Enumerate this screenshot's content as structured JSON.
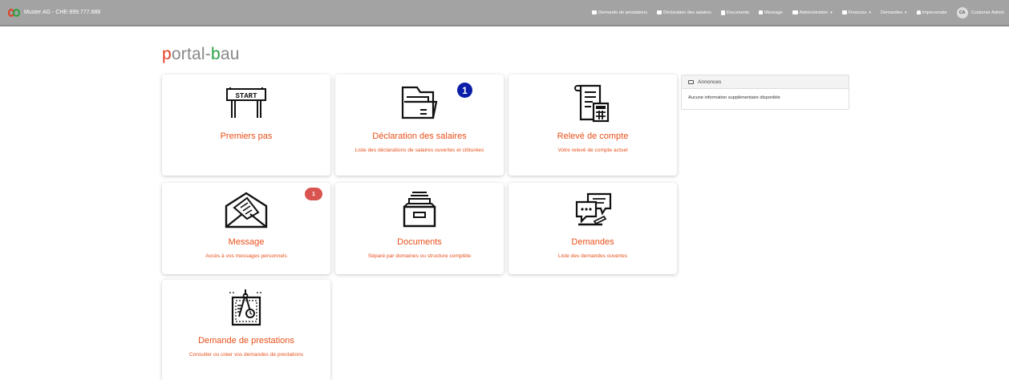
{
  "header": {
    "company": "Muster AG - CHE-999.777.888",
    "nav": [
      {
        "label": "Demande de prestations",
        "icon": "calendar-icon",
        "caret": false
      },
      {
        "label": "Déclaration des salaires",
        "icon": "table-icon",
        "caret": false
      },
      {
        "label": "Documents",
        "icon": "file-icon",
        "caret": false
      },
      {
        "label": "Message",
        "icon": "lock-icon",
        "caret": false
      },
      {
        "label": "Administration",
        "icon": "id-card-icon",
        "caret": true
      },
      {
        "label": "Finances",
        "icon": "table-icon",
        "caret": true
      },
      {
        "label": "Demandes",
        "icon": "",
        "caret": true
      },
      {
        "label": "Impersonate",
        "icon": "user-icon",
        "caret": false
      }
    ],
    "avatar_initials": "CA",
    "user": "Customer Admin",
    "caret": "▾"
  },
  "logo": {
    "p": "p",
    "mid": "ortal-",
    "b": "b",
    "end": "au"
  },
  "cards": [
    {
      "title": "Premiers pas",
      "desc": "",
      "icon": "start-sign-icon",
      "badge": ""
    },
    {
      "title": "Déclaration des salaires",
      "desc": "Liste des déclarations de salaires ouvertes et clôturées",
      "icon": "folder-icon",
      "badge": "1"
    },
    {
      "title": "Relevé de compte",
      "desc": "Votre relevé de compte actuel",
      "icon": "statement-calculator-icon",
      "badge": ""
    },
    {
      "title": "Message",
      "desc": "Accès à vos messages personnels",
      "icon": "envelope-icon",
      "badge": "1"
    },
    {
      "title": "Documents",
      "desc": "Séparé par domaines ou structure complète",
      "icon": "file-drawer-icon",
      "badge": ""
    },
    {
      "title": "Demandes",
      "desc": "Liste des demandes ouvertes",
      "icon": "chat-bubbles-icon",
      "badge": ""
    },
    {
      "title": "Demande de prestations",
      "desc": "Consulter ou créer vos demandes de prestations",
      "icon": "blueprint-compass-icon",
      "badge": ""
    }
  ],
  "announcements": {
    "title": "Annonces",
    "body": "Aucune information supplémentaire disponible"
  },
  "colors": {
    "accent": "#e8501b",
    "logo_red": "#e43a20",
    "logo_green": "#2aa140",
    "badge_blue": "#0a1ea8",
    "badge_red": "#d9534f",
    "topbar": "#a3a3a3"
  }
}
